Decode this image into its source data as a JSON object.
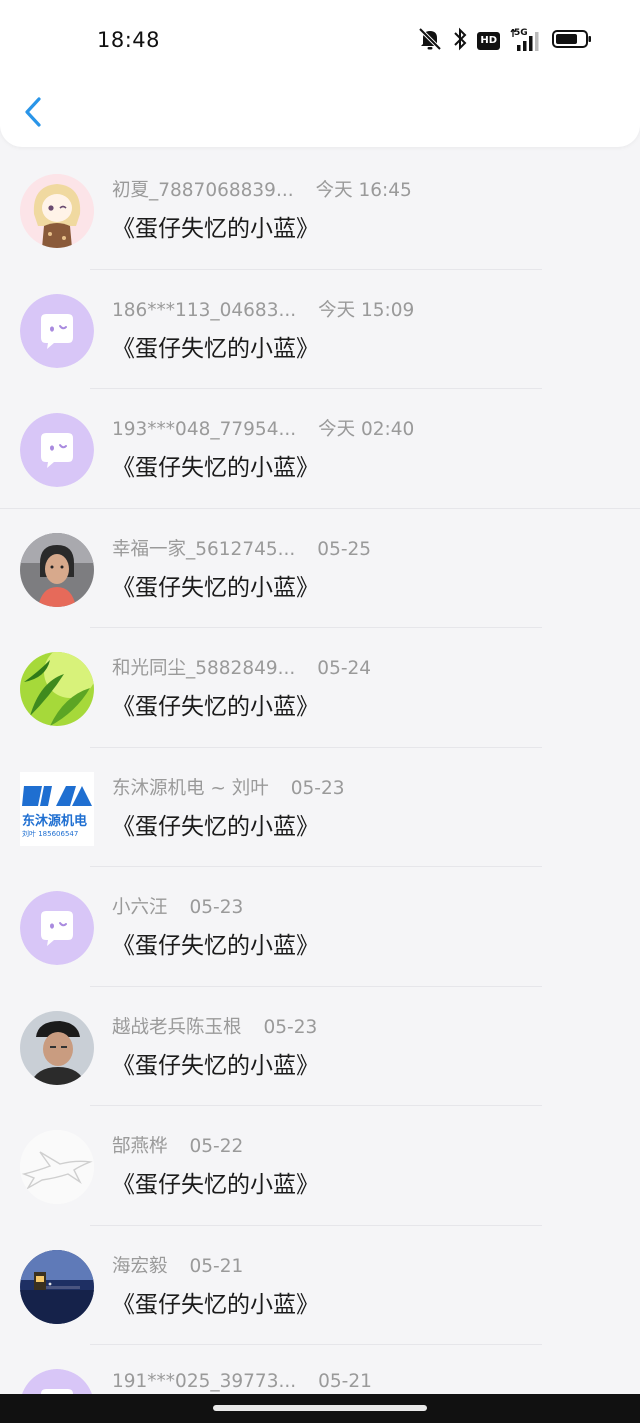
{
  "status_bar": {
    "time": "18:48",
    "icons": [
      "mute-bell-icon",
      "bluetooth-icon",
      "hd-icon",
      "5g-signal-icon",
      "battery-icon"
    ],
    "hd_label": "HD",
    "network_label": "5G"
  },
  "header": {
    "back_icon": "chevron-left-icon",
    "accent_color": "#2a95e8"
  },
  "rows": [
    {
      "name": "初夏_7887068839...",
      "date": "今天 16:45",
      "message": "《蛋仔失忆的小蓝》",
      "avatar": "anime-girl"
    },
    {
      "name": "186***113_04683...",
      "date": "今天 15:09",
      "message": "《蛋仔失忆的小蓝》",
      "avatar": "default-purple"
    },
    {
      "name": "193***048_77954...",
      "date": "今天 02:40",
      "message": "《蛋仔失忆的小蓝》",
      "avatar": "default-purple"
    },
    {
      "name": "幸福一家_5612745...",
      "date": "05-25",
      "message": "《蛋仔失忆的小蓝》",
      "avatar": "woman-photo"
    },
    {
      "name": "和光同尘_5882849...",
      "date": "05-24",
      "message": "《蛋仔失忆的小蓝》",
      "avatar": "green-leaves"
    },
    {
      "name": "东沐源机电 ~ 刘叶",
      "date": "05-23",
      "message": "《蛋仔失忆的小蓝》",
      "avatar": "company-logo",
      "logo_text": "东沐源机电",
      "logo_sub": "刘叶 185606547"
    },
    {
      "name": "小六汪",
      "date": "05-23",
      "message": "《蛋仔失忆的小蓝》",
      "avatar": "default-purple"
    },
    {
      "name": "越战老兵陈玉根",
      "date": "05-23",
      "message": "《蛋仔失忆的小蓝》",
      "avatar": "man-photo"
    },
    {
      "name": "郜燕桦",
      "date": "05-22",
      "message": "《蛋仔失忆的小蓝》",
      "avatar": "bird-sketch"
    },
    {
      "name": "海宏毅",
      "date": "05-21",
      "message": "《蛋仔失忆的小蓝》",
      "avatar": "night-sea"
    },
    {
      "name": "191***025_39773...",
      "date": "05-21",
      "message": "",
      "avatar": "default-purple"
    }
  ]
}
